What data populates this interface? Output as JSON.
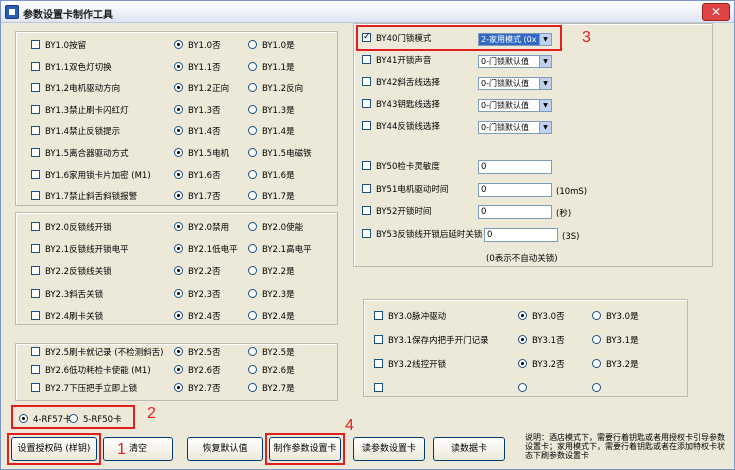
{
  "window": {
    "title": "参数设置卡制作工具",
    "close_label": "✕"
  },
  "bt1": [
    {
      "label": "BY1.0按留",
      "opt_a": "BY1.0否",
      "opt_b": "BY1.0是",
      "sel": "a"
    },
    {
      "label": "BY1.1双色灯切换",
      "opt_a": "BY1.1否",
      "opt_b": "BY1.1是",
      "sel": "a"
    },
    {
      "label": "BY1.2电机驱动方向",
      "opt_a": "BY1.2正向",
      "opt_b": "BY1.2反向",
      "sel": "a"
    },
    {
      "label": "BY1.3禁止刷卡闪红灯",
      "opt_a": "BY1.3否",
      "opt_b": "BY1.3是",
      "sel": "a"
    },
    {
      "label": "BY1.4禁止反锁提示",
      "opt_a": "BY1.4否",
      "opt_b": "BY1.4是",
      "sel": "a"
    },
    {
      "label": "BY1.5离合器驱动方式",
      "opt_a": "BY1.5电机",
      "opt_b": "BY1.5电磁铁",
      "sel": "a"
    },
    {
      "label": "BY1.6家用锁卡片加密 (M1)",
      "opt_a": "BY1.6否",
      "opt_b": "BY1.6是",
      "sel": "a"
    },
    {
      "label": "BY1.7禁止斜舌斜锁报警",
      "opt_a": "BY1.7否",
      "opt_b": "BY1.7是",
      "sel": "a"
    }
  ],
  "bt2": [
    {
      "label": "BY2.0反锁线开锁",
      "opt_a": "BY2.0禁用",
      "opt_b": "BY2.0使能",
      "sel": "a"
    },
    {
      "label": "BY2.1反锁线开锁电平",
      "opt_a": "BY2.1低电平",
      "opt_b": "BY2.1高电平",
      "sel": "a"
    },
    {
      "label": "BY2.2反锁线关锁",
      "opt_a": "BY2.2否",
      "opt_b": "BY2.2是",
      "sel": "a"
    },
    {
      "label": "BY2.3斜舌关锁",
      "opt_a": "BY2.3否",
      "opt_b": "BY2.3是",
      "sel": "a"
    },
    {
      "label": "BY2.4刷卡关锁",
      "opt_a": "BY2.4否",
      "opt_b": "BY2.4是",
      "sel": "a"
    }
  ],
  "bt2b": [
    {
      "label": "BY2.5刷卡就记录 (不检测斜舌)",
      "opt_a": "BY2.5否",
      "opt_b": "BY2.5是",
      "sel": "a"
    },
    {
      "label": "BY2.6低功耗检卡使能 (M1)",
      "opt_a": "BY2.6否",
      "opt_b": "BY2.6是",
      "sel": "a"
    },
    {
      "label": "BY2.7下压把手立即上锁",
      "opt_a": "BY2.7否",
      "opt_b": "BY2.7是",
      "sel": "a"
    }
  ],
  "card_type": {
    "opt_a": "4-RF57卡",
    "opt_b": "5-RF50卡"
  },
  "by4": [
    {
      "label": "BY40门锁模式",
      "value": "2-家用模式 (0x",
      "checked": true
    },
    {
      "label": "BY41开锁声音",
      "value": "0-门锁默认值",
      "checked": false
    },
    {
      "label": "BY42斜舌线选择",
      "value": "0-门锁默认值",
      "checked": false
    },
    {
      "label": "BY43钥匙线选择",
      "value": "0-门锁默认值",
      "checked": false
    },
    {
      "label": "BY44反锁线选择",
      "value": "0-门锁默认值",
      "checked": false
    }
  ],
  "by5": [
    {
      "label": "BY50检卡灵敏度",
      "value": "0",
      "unit": ""
    },
    {
      "label": "BY51电机驱动时间",
      "value": "0",
      "unit": "(10mS)"
    },
    {
      "label": "BY52开锁时间",
      "value": "0",
      "unit": "(秒)"
    },
    {
      "label": "BY53反锁线开锁后延时关锁",
      "value": "0",
      "unit": "(3S)"
    }
  ],
  "by53_note": "(0表示不自动关锁)",
  "by3": [
    {
      "label": "BY3.0脉冲驱动",
      "opt_a": "BY3.0否",
      "opt_b": "BY3.0是"
    },
    {
      "label": "BY3.1保存内把手开门记录",
      "opt_a": "BY3.1否",
      "opt_b": "BY3.1是"
    },
    {
      "label": "BY3.2线控开锁",
      "opt_a": "BY3.2否",
      "opt_b": "BY3.2是"
    },
    {
      "label": "",
      "opt_a": "",
      "opt_b": ""
    }
  ],
  "buttons": {
    "auth": "设置授权码 (样钥)",
    "clear": "清空",
    "restore": "恢复默认值",
    "make": "制作参数设置卡",
    "read_param": "读参数设置卡",
    "read_card": "读数据卡"
  },
  "note": "说明：酒店模式下，需要行着钥匙或者用授权卡引导参数设置卡；家用模式下，需要行着钥匙或者在添加特权卡状态下刷参数设置卡",
  "annotations": [
    "1",
    "2",
    "3",
    "4"
  ],
  "colors": {
    "accent": "#e21e1e",
    "selection": "#316ac5"
  }
}
